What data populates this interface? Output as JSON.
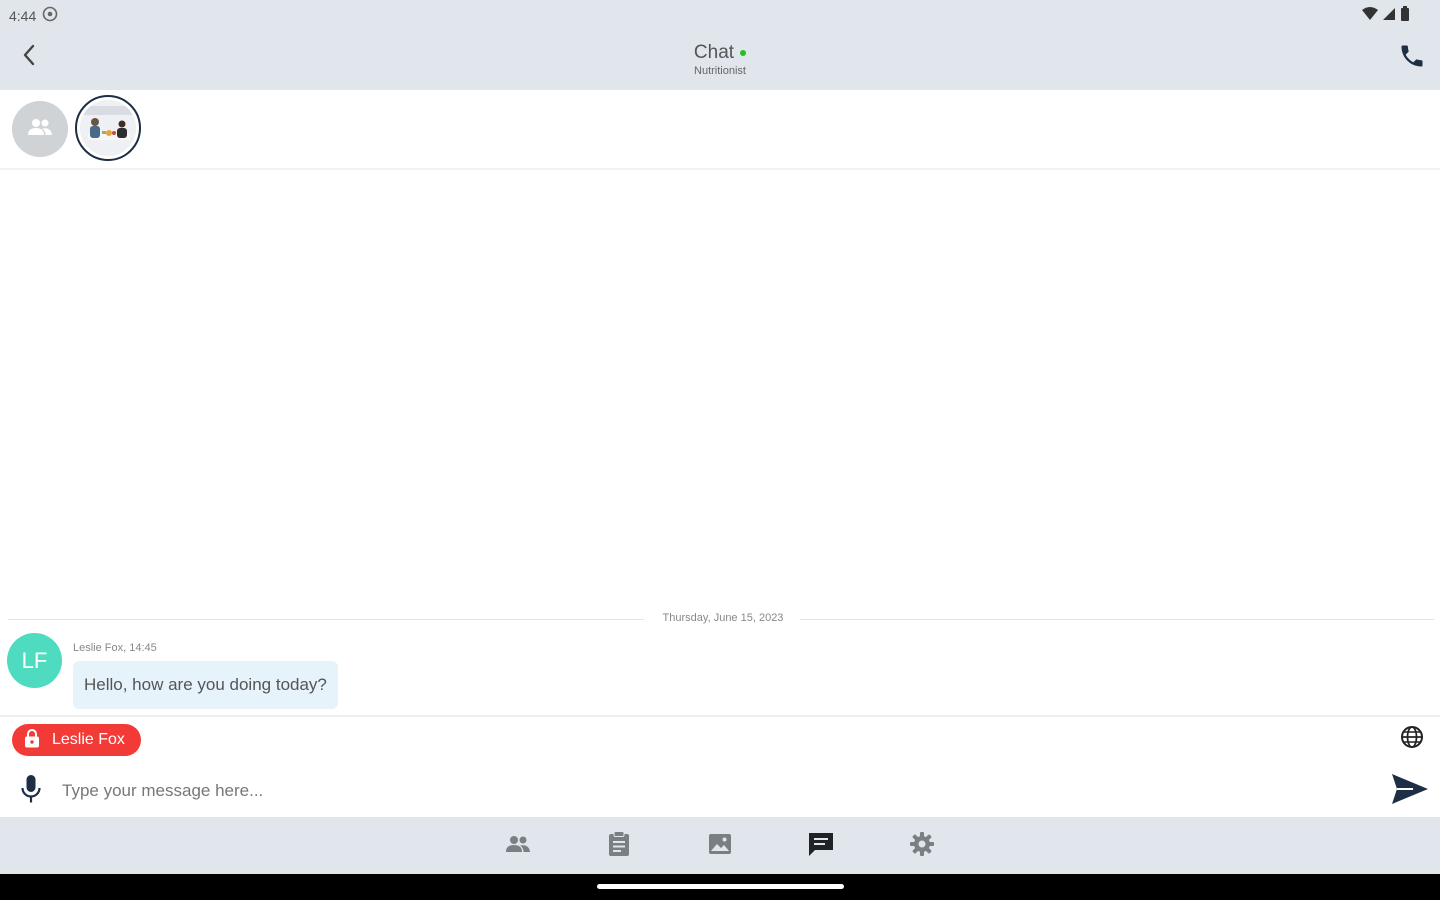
{
  "status_bar": {
    "time": "4:44",
    "icons": [
      "settings-notification-icon",
      "wifi-icon",
      "signal-icon",
      "battery-icon"
    ]
  },
  "header": {
    "title": "Chat",
    "subtitle": "Nutritionist",
    "online_color": "#1ec31e"
  },
  "participants": {
    "items": [
      {
        "name": "group-avatar",
        "icon": "group-icon"
      },
      {
        "name": "photo-avatar",
        "icon": "photo"
      }
    ]
  },
  "conversation": {
    "date_divider": "Thursday, June 15, 2023",
    "messages": [
      {
        "initials": "LF",
        "meta": "Leslie Fox, 14:45",
        "text": "Hello, how are you doing today?",
        "avatar_color": "#4edbc0"
      }
    ]
  },
  "composer": {
    "recipient": "Leslie Fox",
    "recipient_color": "#f23a37",
    "placeholder": "Type your message here...",
    "value": ""
  },
  "bottom_nav": {
    "items": [
      {
        "icon": "people-icon"
      },
      {
        "icon": "clipboard-icon"
      },
      {
        "icon": "image-icon"
      },
      {
        "icon": "chat-icon",
        "active": true
      },
      {
        "icon": "settings-icon"
      }
    ]
  },
  "colors": {
    "bar_bg": "#e1e6ec",
    "accent_navy": "#1d2e45"
  }
}
